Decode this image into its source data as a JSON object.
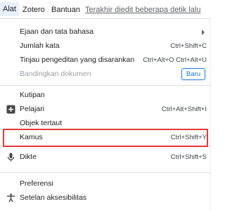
{
  "menubar": {
    "alat": "Alat",
    "zotero": "Zotero",
    "bantuan": "Bantuan",
    "status": "Terakhir diedit beberapa detik lalu"
  },
  "menu": {
    "ejaan": {
      "label": "Ejaan dan tata bahasa"
    },
    "jumlah": {
      "label": "Jumlah kata",
      "shortcut": "Ctrl+Shift+C"
    },
    "tinjau": {
      "label": "Tinjau pengeditan yang disarankan",
      "shortcut": "Ctrl+Alt+O Ctrl+Alt+U"
    },
    "bandingkan": {
      "label": "Bandingkan dokumen",
      "badge": "Baru"
    },
    "kutipan": {
      "label": "Kutipan"
    },
    "pelajari": {
      "label": "Pelajari",
      "shortcut": "Ctrl+Alt+Shift+I",
      "icon": "plus-box-icon"
    },
    "objek": {
      "label": "Objek tertaut"
    },
    "kamus": {
      "label": "Kamus",
      "shortcut": "Ctrl+Shift+Y"
    },
    "dikte": {
      "label": "Dikte",
      "shortcut": "Ctrl+Shift+S",
      "icon": "microphone-icon"
    },
    "preferensi": {
      "label": "Preferensi"
    },
    "setelan": {
      "label": "Setelan aksesibilitas",
      "icon": "accessibility-icon"
    }
  },
  "colors": {
    "highlight_border": "#e53935",
    "badge_blue": "#1a73e8",
    "active_menu_bg": "#e8f0fe"
  }
}
